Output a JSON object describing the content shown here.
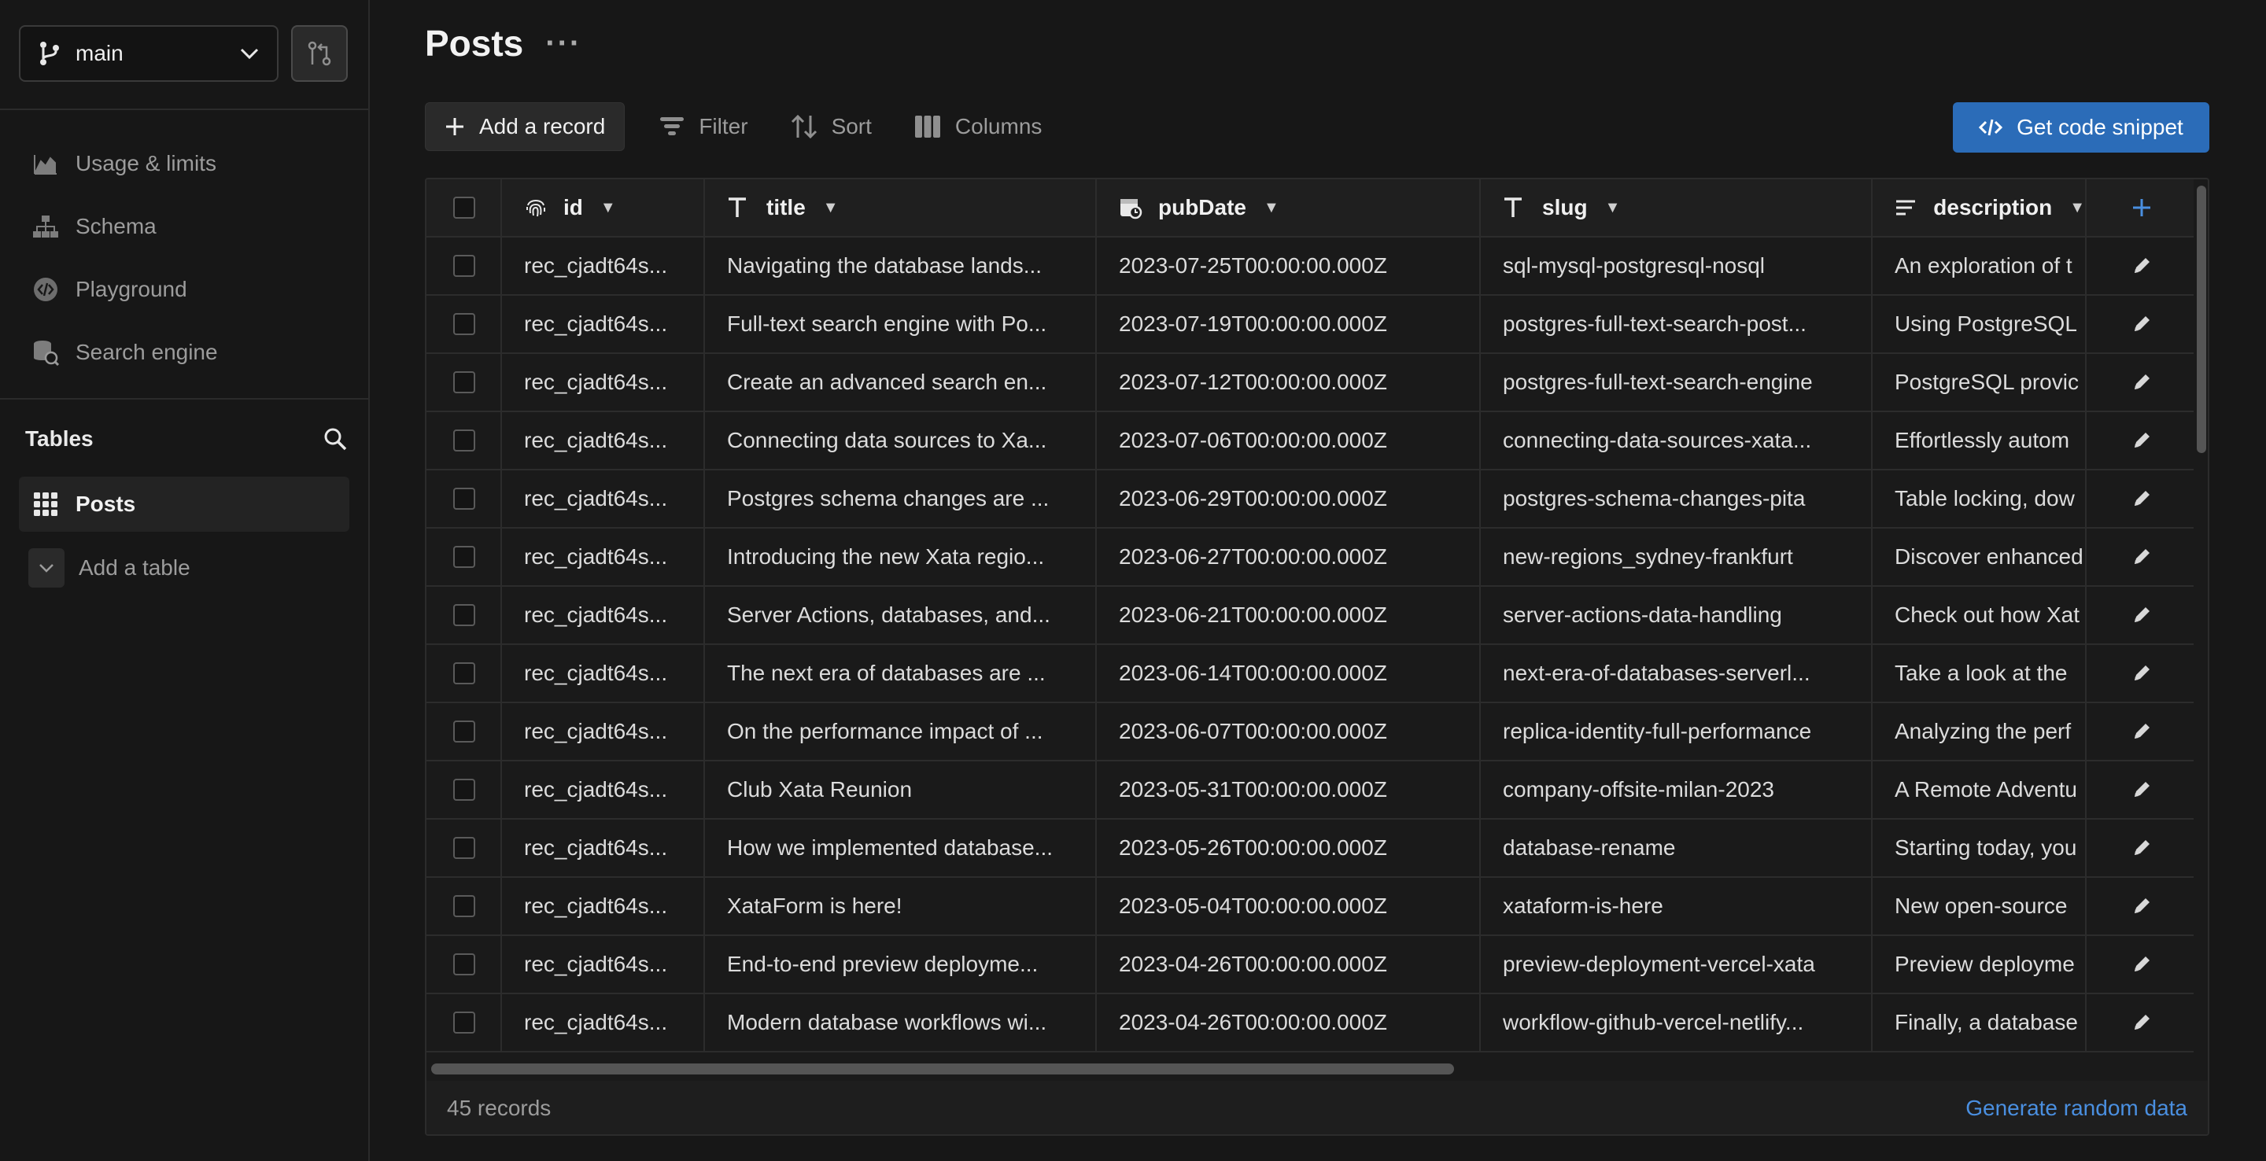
{
  "sidebar": {
    "branch": "main",
    "nav": [
      {
        "label": "Usage & limits",
        "icon": "chart-icon"
      },
      {
        "label": "Schema",
        "icon": "schema-icon"
      },
      {
        "label": "Playground",
        "icon": "playground-icon"
      },
      {
        "label": "Search engine",
        "icon": "search-engine-icon"
      }
    ],
    "tables_title": "Tables",
    "tables": [
      {
        "label": "Posts"
      }
    ],
    "add_table": "Add a table"
  },
  "page": {
    "title": "Posts",
    "more": "···"
  },
  "toolbar": {
    "add_record": "Add a record",
    "filter": "Filter",
    "sort": "Sort",
    "columns": "Columns",
    "code_snippet": "Get code snippet"
  },
  "table": {
    "columns": [
      {
        "name": "id",
        "type": "id"
      },
      {
        "name": "title",
        "type": "text"
      },
      {
        "name": "pubDate",
        "type": "datetime"
      },
      {
        "name": "slug",
        "type": "text"
      },
      {
        "name": "description",
        "type": "longtext"
      }
    ],
    "rows": [
      [
        "rec_cjadt64s...",
        "Navigating the database lands...",
        "2023-07-25T00:00:00.000Z",
        "sql-mysql-postgresql-nosql",
        "An exploration of t"
      ],
      [
        "rec_cjadt64s...",
        "Full-text search engine with Po...",
        "2023-07-19T00:00:00.000Z",
        "postgres-full-text-search-post...",
        "Using PostgreSQL"
      ],
      [
        "rec_cjadt64s...",
        "Create an advanced search en...",
        "2023-07-12T00:00:00.000Z",
        "postgres-full-text-search-engine",
        "PostgreSQL provic"
      ],
      [
        "rec_cjadt64s...",
        "Connecting data sources to Xa...",
        "2023-07-06T00:00:00.000Z",
        "connecting-data-sources-xata...",
        "Effortlessly autom"
      ],
      [
        "rec_cjadt64s...",
        "Postgres schema changes are ...",
        "2023-06-29T00:00:00.000Z",
        "postgres-schema-changes-pita",
        "Table locking, dow"
      ],
      [
        "rec_cjadt64s...",
        "Introducing the new Xata regio...",
        "2023-06-27T00:00:00.000Z",
        "new-regions_sydney-frankfurt",
        "Discover enhanced"
      ],
      [
        "rec_cjadt64s...",
        "Server Actions, databases, and...",
        "2023-06-21T00:00:00.000Z",
        "server-actions-data-handling",
        "Check out how Xat"
      ],
      [
        "rec_cjadt64s...",
        "The next era of databases are ...",
        "2023-06-14T00:00:00.000Z",
        "next-era-of-databases-serverl...",
        "Take a look at the"
      ],
      [
        "rec_cjadt64s...",
        "On the performance impact of ...",
        "2023-06-07T00:00:00.000Z",
        "replica-identity-full-performance",
        "Analyzing the perf"
      ],
      [
        "rec_cjadt64s...",
        "Club Xata Reunion",
        "2023-05-31T00:00:00.000Z",
        "company-offsite-milan-2023",
        "A Remote Adventu"
      ],
      [
        "rec_cjadt64s...",
        "How we implemented database...",
        "2023-05-26T00:00:00.000Z",
        "database-rename",
        "Starting today, you"
      ],
      [
        "rec_cjadt64s...",
        "XataForm is here!",
        "2023-05-04T00:00:00.000Z",
        "xataform-is-here",
        "New open-source"
      ],
      [
        "rec_cjadt64s...",
        "End-to-end preview deployme...",
        "2023-04-26T00:00:00.000Z",
        "preview-deployment-vercel-xata",
        "Preview deployme"
      ],
      [
        "rec_cjadt64s...",
        "Modern database workflows wi...",
        "2023-04-26T00:00:00.000Z",
        "workflow-github-vercel-netlify...",
        "Finally, a database"
      ]
    ]
  },
  "footer": {
    "records": "45 records",
    "generate": "Generate random data"
  },
  "colors": {
    "accent": "#2b6cb8",
    "link": "#4a8fe0",
    "background": "#171717"
  }
}
